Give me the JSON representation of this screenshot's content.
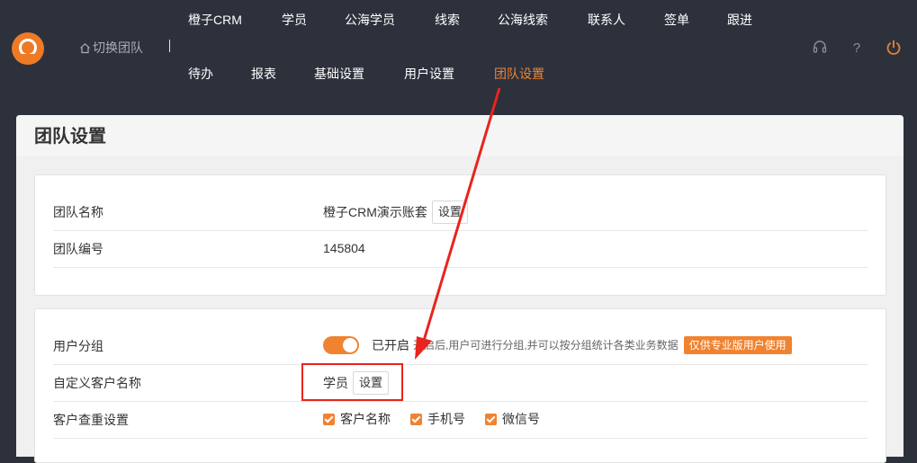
{
  "brand": {
    "color": "#f08330"
  },
  "header": {
    "switch_team": "切换团队",
    "nav_row1": [
      "橙子CRM",
      "学员",
      "公海学员",
      "线索",
      "公海线索",
      "联系人",
      "签单",
      "跟进"
    ],
    "nav_row2": [
      "待办",
      "报表",
      "基础设置",
      "用户设置",
      "团队设置"
    ],
    "icons": [
      "headset-icon",
      "help-icon",
      "power-icon"
    ]
  },
  "page": {
    "title": "团队设置"
  },
  "team_info": {
    "name_label": "团队名称",
    "name_value": "橙子CRM演示账套",
    "name_button": "设置",
    "id_label": "团队编号",
    "id_value": "145804"
  },
  "settings": {
    "user_group": {
      "label": "用户分组",
      "state_text": "已开启",
      "hint": "开启后,用户可进行分组,并可以按分组统计各类业务数据",
      "badge": "仅供专业版用户使用"
    },
    "custom_name": {
      "label": "自定义客户名称",
      "value": "学员",
      "button": "设置"
    },
    "dedupe": {
      "label": "客户查重设置",
      "options": [
        "客户名称",
        "手机号",
        "微信号"
      ]
    }
  }
}
